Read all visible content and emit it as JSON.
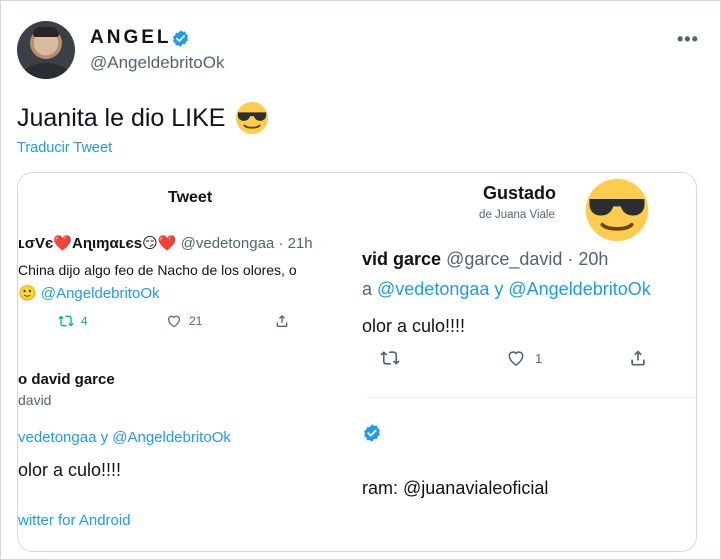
{
  "author": {
    "display_name": "ANGEL",
    "handle": "@AngeldebritoOk",
    "more_label": "•••"
  },
  "tweet": {
    "text": "Juanita le dio LIKE",
    "translate_label": "Traducir Tweet"
  },
  "left_shot": {
    "title": "Tweet",
    "row1_name": "ʟσVє❤️Aɳιɱαʟєѕ😏❤️",
    "row1_handle": "@vedetongaa · 21h",
    "row1_text": "China dijo algo feo de Nacho de los olores, o",
    "row1_mention_emoji": "🙂",
    "row1_mention": "@AngeldebritoOk",
    "retweets": "4",
    "likes": "21",
    "row2_name": "o david garce",
    "row2_handle": "david",
    "row2_mentions": "vedetongaa y @AngeldebritoOk",
    "row2_text": "olor a culo!!!!",
    "row2_source": "witter for Android"
  },
  "right_shot": {
    "title": "Gustado",
    "subtitle": "de Juana Viale",
    "row_name": "vid garce",
    "row_handle": "@garce_david · 20h",
    "reply_prefix": "a ",
    "reply_mentions": "@vedetongaa y @AngeldebritoOk",
    "row_text": "olor a culo!!!!",
    "likes": "1",
    "bio_prefix": "ram: ",
    "bio_handle": "@juanavialeoficial"
  },
  "colors": {
    "accent": "#1d9bf0",
    "text": "#0f1419",
    "muted": "#536471",
    "retweet": "#00ba7c",
    "border": "#cfd9de"
  },
  "icons": [
    "verified-badge-icon",
    "more-options-icon",
    "sunglasses-emoji-icon",
    "reply-icon",
    "retweet-icon",
    "like-icon",
    "share-icon"
  ]
}
